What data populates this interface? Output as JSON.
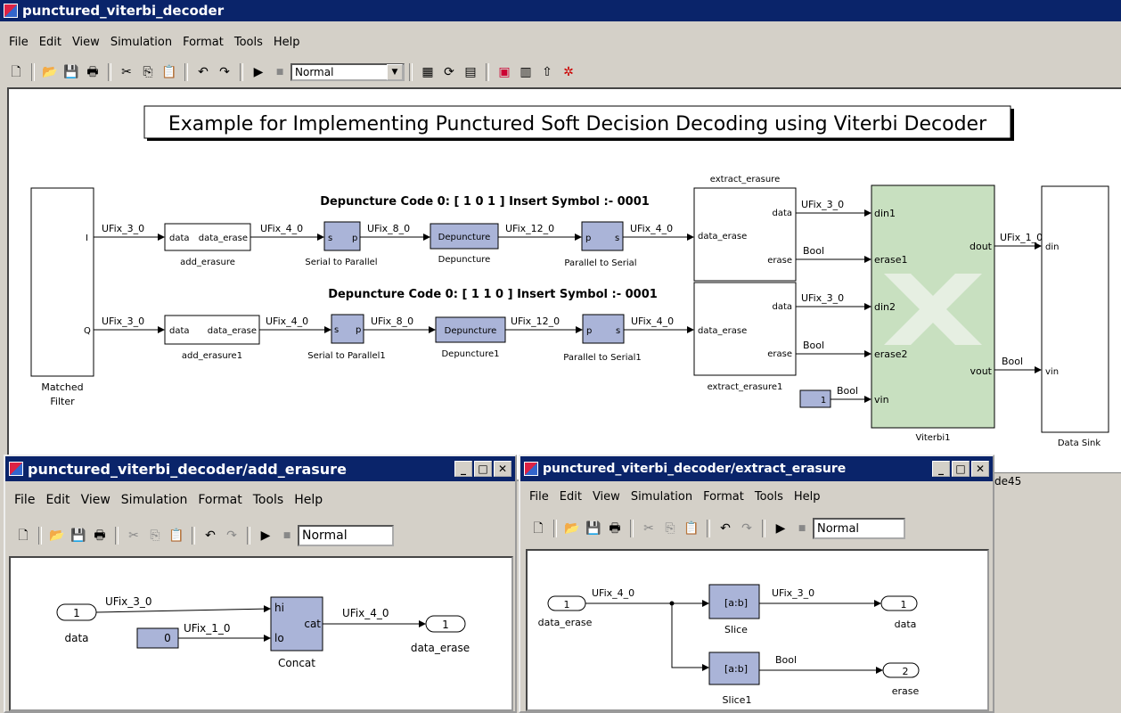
{
  "main": {
    "title": "punctured_viterbi_decoder",
    "menu": [
      "File",
      "Edit",
      "View",
      "Simulation",
      "Format",
      "Tools",
      "Help"
    ],
    "sim_mode": "Normal",
    "banner": "Example for Implementing Punctured Soft Decision Decoding using Viterbi Decoder",
    "code_label_1": "Depuncture Code 0: [ 1 0 1 ] Insert Symbol :- 0001",
    "code_label_2": "Depuncture Code 0: [ 1 1 0 ] Insert Symbol :- 0001",
    "blocks": {
      "matched_filter": {
        "name": "Matched Filter",
        "port_i": "I",
        "port_q": "Q"
      },
      "add_erasure": {
        "name": "add_erasure",
        "in": "data",
        "out": "data_erase"
      },
      "add_erasure1": {
        "name": "add_erasure1",
        "in": "data",
        "out": "data_erase"
      },
      "s2p": {
        "name": "Serial to Parallel",
        "in": "s",
        "out": "p"
      },
      "s2p1": {
        "name": "Serial to Parallel1",
        "in": "s",
        "out": "p"
      },
      "depuncture": {
        "name": "Depuncture",
        "label": "Depuncture"
      },
      "depuncture1": {
        "name": "Depuncture1",
        "label": "Depuncture"
      },
      "p2s": {
        "name": "Parallel to Serial",
        "in": "p",
        "out": "s"
      },
      "p2s1": {
        "name": "Parallel to Serial1",
        "in": "p",
        "out": "s"
      },
      "extract": {
        "name": "extract_erasure",
        "in": "data_erase",
        "out1": "data",
        "out2": "erase"
      },
      "extract1": {
        "name": "extract_erasure1",
        "in": "data_erase",
        "out1": "data",
        "out2": "erase"
      },
      "const1": {
        "value": "1"
      },
      "viterbi": {
        "name": "Viterbi1",
        "ports_in": [
          "din1",
          "erase1",
          "din2",
          "erase2",
          "vin"
        ],
        "ports_out": [
          "dout",
          "vout"
        ]
      },
      "sink": {
        "name": "Data Sink",
        "ports": [
          "din",
          "vin"
        ]
      }
    },
    "signals": {
      "i_in": "UFix_3_0",
      "q_in": "UFix_3_0",
      "ae_out": "UFix_4_0",
      "ae1_out": "UFix_4_0",
      "s2p_out": "UFix_8_0",
      "s2p1_out": "UFix_8_0",
      "dep_out": "UFix_12_0",
      "dep1_out": "UFix_12_0",
      "p2s_out": "UFix_4_0",
      "p2s1_out": "UFix_4_0",
      "ex_data": "UFix_3_0",
      "ex_erase": "Bool",
      "ex1_data": "UFix_3_0",
      "ex1_erase": "Bool",
      "const_out": "Bool",
      "dout": "UFix_1_0",
      "vout": "Bool"
    },
    "status_text": "de45"
  },
  "add_erasure_window": {
    "title": "punctured_viterbi_decoder/add_erasure",
    "menu": [
      "File",
      "Edit",
      "View",
      "Simulation",
      "Format",
      "Tools",
      "Help"
    ],
    "sim_mode": "Normal",
    "in_port": {
      "num": "1",
      "name": "data"
    },
    "const": {
      "value": "0"
    },
    "concat": {
      "name": "Concat",
      "hi": "hi",
      "lo": "lo",
      "out": "cat"
    },
    "out_port": {
      "num": "1",
      "name": "data_erase"
    },
    "signals": {
      "in": "UFix_3_0",
      "const": "UFix_1_0",
      "out": "UFix_4_0"
    }
  },
  "extract_erasure_window": {
    "title": "punctured_viterbi_decoder/extract_erasure",
    "menu": [
      "File",
      "Edit",
      "View",
      "Simulation",
      "Format",
      "Tools",
      "Help"
    ],
    "sim_mode": "Normal",
    "in_port": {
      "num": "1",
      "name": "data_erase"
    },
    "slice": {
      "name": "Slice",
      "label": "[a:b]"
    },
    "slice1": {
      "name": "Slice1",
      "label": "[a:b]"
    },
    "out1": {
      "num": "1",
      "name": "data"
    },
    "out2": {
      "num": "2",
      "name": "erase"
    },
    "signals": {
      "in": "UFix_4_0",
      "s1": "UFix_3_0",
      "s2": "Bool"
    }
  },
  "colors": {
    "titlebar": "#0a246a",
    "viterbi_fill": "#c8e0c0",
    "xblock_fill": "#aab4d8"
  }
}
